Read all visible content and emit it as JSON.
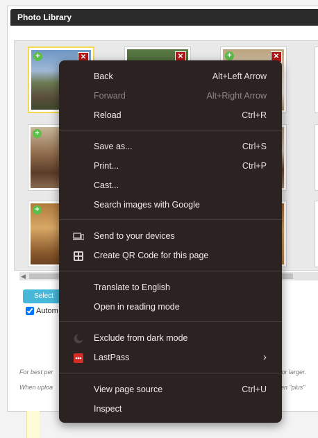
{
  "panel": {
    "title": "Photo Library"
  },
  "controls": {
    "select_label": "Select",
    "auto_label": "Autom",
    "auto_checked": true
  },
  "hints": {
    "line1_left": "For best per",
    "line1_right": "s for larger.",
    "line2_left": "When uploa",
    "line2_right": "reen \"plus\""
  },
  "context_menu": {
    "items": [
      {
        "label": "Back",
        "shortcut": "Alt+Left Arrow",
        "disabled": false
      },
      {
        "label": "Forward",
        "shortcut": "Alt+Right Arrow",
        "disabled": true
      },
      {
        "label": "Reload",
        "shortcut": "Ctrl+R",
        "disabled": false
      },
      {
        "label": "Save as...",
        "shortcut": "Ctrl+S",
        "disabled": false
      },
      {
        "label": "Print...",
        "shortcut": "Ctrl+P",
        "disabled": false
      },
      {
        "label": "Cast...",
        "shortcut": "",
        "disabled": false
      },
      {
        "label": "Search images with Google",
        "shortcut": "",
        "disabled": false
      },
      {
        "label": "Send to your devices",
        "shortcut": "",
        "icon": "devices-icon"
      },
      {
        "label": "Create QR Code for this page",
        "shortcut": "",
        "icon": "qr-code-icon"
      },
      {
        "label": "Translate to English",
        "shortcut": ""
      },
      {
        "label": "Open in reading mode",
        "shortcut": ""
      },
      {
        "label": "Exclude from dark mode",
        "shortcut": "",
        "icon": "moon-icon"
      },
      {
        "label": "LastPass",
        "shortcut": "",
        "icon": "lastpass-icon",
        "submenu": "›"
      },
      {
        "label": "View page source",
        "shortcut": "Ctrl+U"
      },
      {
        "label": "Inspect",
        "shortcut": ""
      }
    ]
  },
  "colors": {
    "menu_bg": "#2b2221",
    "header_bg": "#2b2b2b",
    "select_btn": "#47b8d8",
    "delete": "#b31616",
    "add": "#5bbf4a"
  }
}
